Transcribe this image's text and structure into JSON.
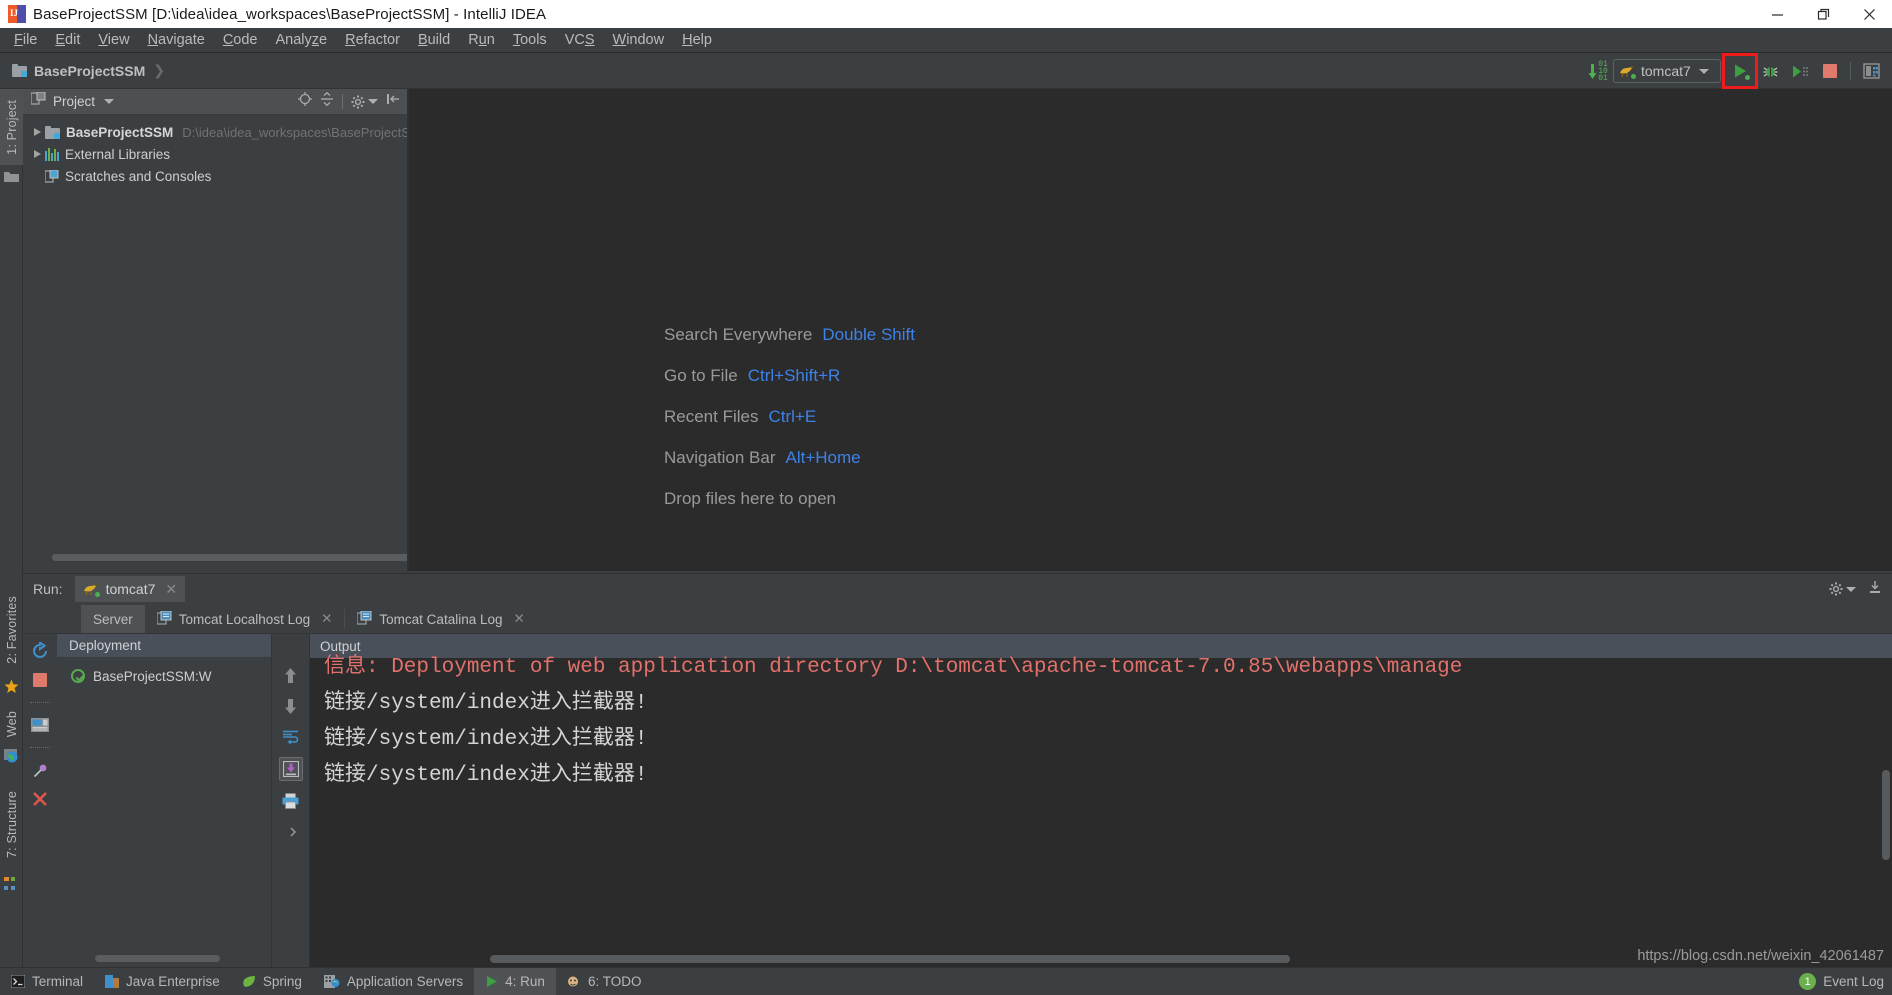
{
  "window": {
    "title": "BaseProjectSSM [D:\\idea\\idea_workspaces\\BaseProjectSSM] - IntelliJ IDEA",
    "app_icon": "intellij-idea-icon",
    "controls": {
      "minimize": "minimize-icon",
      "maximize": "maximize-icon",
      "close": "close-icon"
    }
  },
  "menubar": {
    "items": [
      {
        "label": "File",
        "mnemonic": "F"
      },
      {
        "label": "Edit",
        "mnemonic": "E"
      },
      {
        "label": "View",
        "mnemonic": "V"
      },
      {
        "label": "Navigate",
        "mnemonic": "N"
      },
      {
        "label": "Code",
        "mnemonic": "C"
      },
      {
        "label": "Analyze",
        "mnemonic": "z"
      },
      {
        "label": "Refactor",
        "mnemonic": "R"
      },
      {
        "label": "Build",
        "mnemonic": "B"
      },
      {
        "label": "Run",
        "mnemonic": "u"
      },
      {
        "label": "Tools",
        "mnemonic": "T"
      },
      {
        "label": "VCS",
        "mnemonic": "S"
      },
      {
        "label": "Window",
        "mnemonic": "W"
      },
      {
        "label": "Help",
        "mnemonic": "H"
      }
    ]
  },
  "navbar": {
    "breadcrumb": "BaseProjectSSM",
    "run_config": "tomcat7",
    "buttons": {
      "update_running_app": "update-running-application-icon",
      "run": "run-icon",
      "debug": "debug-icon",
      "run_coverage": "run-with-coverage-icon",
      "stop": "stop-icon",
      "layout": "restore-layout-icon"
    },
    "highlight_color": "#f01c1c"
  },
  "left_strip": {
    "tabs": [
      {
        "label": "1: Project",
        "icon": "project-folder-icon",
        "active": true
      },
      {
        "label": "2: Favorites",
        "icon": "star-icon",
        "active": false
      },
      {
        "label": "Web",
        "icon": "web-globe-icon",
        "active": false
      },
      {
        "label": "7: Structure",
        "icon": "structure-icon",
        "active": false
      }
    ]
  },
  "project_panel": {
    "title": "Project",
    "header_icons": [
      "locate-icon",
      "collapse-all-icon",
      "settings-gear-icon",
      "hide-icon"
    ],
    "tree": [
      {
        "label": "BaseProjectSSM",
        "sub": "D:\\idea\\idea_workspaces\\BaseProjectSS",
        "icon": "module-folder-icon",
        "expandable": true,
        "bold": true
      },
      {
        "label": "External Libraries",
        "sub": "",
        "icon": "libraries-icon",
        "expandable": true,
        "bold": false
      },
      {
        "label": "Scratches and Consoles",
        "sub": "",
        "icon": "scratches-icon",
        "expandable": false,
        "bold": false
      }
    ]
  },
  "editor": {
    "hints": [
      {
        "name": "Search Everywhere",
        "key": "Double Shift"
      },
      {
        "name": "Go to File",
        "key": "Ctrl+Shift+R"
      },
      {
        "name": "Recent Files",
        "key": "Ctrl+E"
      },
      {
        "name": "Navigation Bar",
        "key": "Alt+Home"
      },
      {
        "name": "Drop files here to open",
        "key": ""
      }
    ],
    "link_color": "#3d82e8"
  },
  "run_window": {
    "label": "Run:",
    "tab": {
      "name": "tomcat7",
      "icon": "tomcat-icon",
      "close": "close-icon"
    },
    "header_right_icons": [
      "settings-gear-icon",
      "hide-icon"
    ],
    "inner_tabs": [
      {
        "label": "Server",
        "icon": "",
        "active": true,
        "closable": false
      },
      {
        "label": "Tomcat Localhost Log",
        "icon": "log-icon",
        "active": false,
        "closable": true
      },
      {
        "label": "Tomcat Catalina Log",
        "icon": "log-icon",
        "active": false,
        "closable": true
      }
    ],
    "sidebar_icons": [
      "rerun-icon",
      "stop-icon",
      "restart-server-icon",
      "show-console-icon",
      "pin-tab-icon",
      "close-tab-icon"
    ],
    "deployment": {
      "header": "Deployment",
      "items": [
        {
          "label": "BaseProjectSSM:W",
          "status": "deployed-ok-icon"
        }
      ]
    },
    "output": {
      "header": "Output",
      "tool_icons": [
        "scroll-up-icon",
        "scroll-down-icon",
        "soft-wrap-icon",
        "scroll-to-end-icon",
        "print-icon",
        "more-icon"
      ],
      "lines": [
        {
          "text": "信息: Deployment of web application directory D:\\tomcat\\apache-tomcat-7.0.85\\webapps\\manage",
          "type": "error"
        },
        {
          "text": "链接/system/index进入拦截器!",
          "type": "out"
        },
        {
          "text": "链接/system/index进入拦截器!",
          "type": "out"
        },
        {
          "text": "链接/system/index进入拦截器!",
          "type": "out"
        }
      ],
      "error_color": "#e2716c",
      "text_color": "#d4d4d4"
    }
  },
  "statusbar": {
    "items": [
      {
        "label": "Terminal",
        "icon": "terminal-icon",
        "active": false
      },
      {
        "label": "Java Enterprise",
        "icon": "java-enterprise-icon",
        "active": false
      },
      {
        "label": "Spring",
        "icon": "spring-leaf-icon",
        "active": false
      },
      {
        "label": "Application Servers",
        "icon": "application-servers-icon",
        "active": false
      },
      {
        "label": "4: Run",
        "icon": "run-icon",
        "active": true
      },
      {
        "label": "6: TODO",
        "icon": "todo-icon",
        "active": false
      }
    ],
    "event_log": {
      "label": "Event Log",
      "count": "1",
      "badge_color": "#6ab04c"
    }
  },
  "watermark": "https://blog.csdn.net/weixin_42061487"
}
